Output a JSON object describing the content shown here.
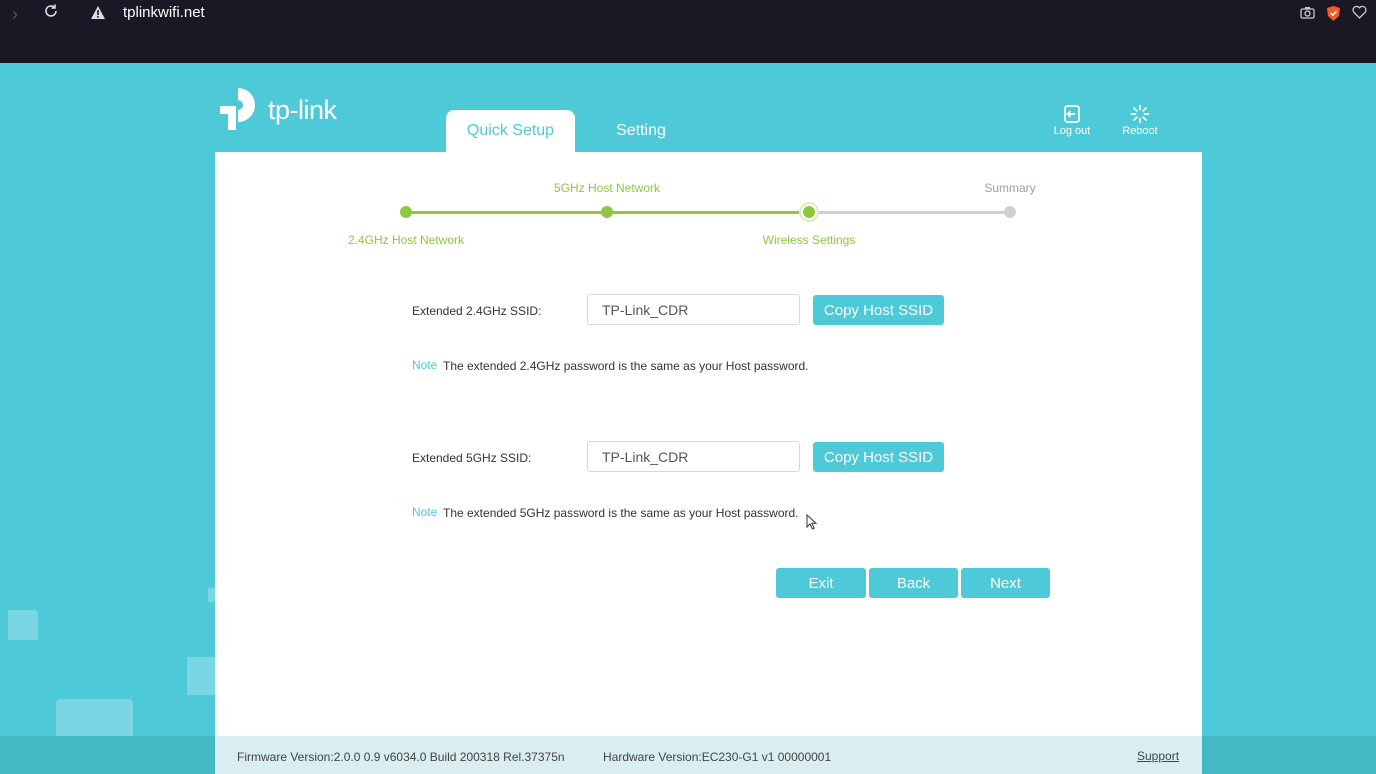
{
  "browser": {
    "url": "tplinkwifi.net",
    "icons": [
      "forward-icon",
      "reload-icon",
      "warning-icon",
      "camera-icon",
      "brave-shield-icon",
      "heart-icon"
    ]
  },
  "header": {
    "logo_text": "tp-link",
    "tabs": [
      {
        "label": "Quick Setup",
        "active": true
      },
      {
        "label": "Setting",
        "active": false
      }
    ],
    "logout_label": "Log out",
    "reboot_label": "Reboot"
  },
  "steps": [
    {
      "label": "2.4GHz Host Network",
      "state": "done"
    },
    {
      "label": "5GHz Host Network",
      "state": "done"
    },
    {
      "label": "Wireless Settings",
      "state": "current"
    },
    {
      "label": "Summary",
      "state": "pending"
    }
  ],
  "form": {
    "ssid24_label": "Extended 2.4GHz SSID:",
    "ssid24_value": "TP-Link_CDR",
    "copy_label": "Copy Host SSID",
    "note_keyword": "Note",
    "note24_text": "The extended 2.4GHz password is the same as your Host password.",
    "ssid5_label": "Extended 5GHz SSID:",
    "ssid5_value": "TP-Link_CDR",
    "note5_text": "The extended 5GHz password is the same as your Host password."
  },
  "actions": {
    "exit": "Exit",
    "back": "Back",
    "next": "Next"
  },
  "footer": {
    "firmware": "Firmware Version:2.0.0 0.9 v6034.0 Build 200318 Rel.37375n",
    "hardware": "Hardware Version:EC230-G1 v1 00000001",
    "support": "Support"
  },
  "colors": {
    "brand": "#4ec9d8",
    "progress_done": "#8fc741",
    "progress_pending": "#cfcfcf",
    "chrome_bg": "#1c1725"
  }
}
